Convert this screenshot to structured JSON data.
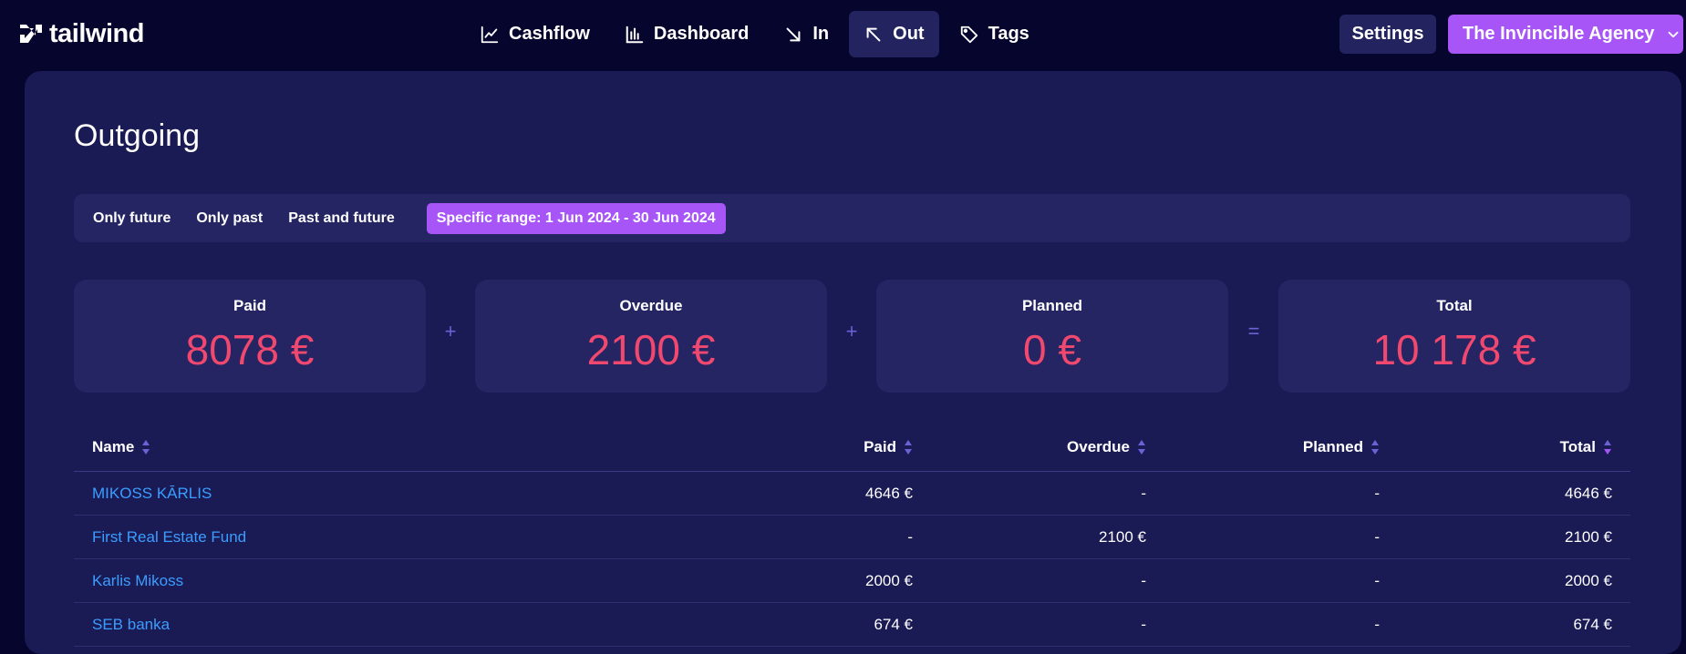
{
  "app": {
    "logo_text": "tailwind"
  },
  "nav": [
    {
      "label": "Cashflow",
      "icon": "line-chart-icon"
    },
    {
      "label": "Dashboard",
      "icon": "bar-chart-icon"
    },
    {
      "label": "In",
      "icon": "arrow-down-right-icon"
    },
    {
      "label": "Out",
      "icon": "arrow-up-left-icon",
      "active": true
    },
    {
      "label": "Tags",
      "icon": "tag-icon"
    }
  ],
  "header": {
    "settings_label": "Settings",
    "org_label": "The Invincible Agency"
  },
  "page": {
    "title": "Outgoing"
  },
  "filters": [
    {
      "label": "Only future"
    },
    {
      "label": "Only past"
    },
    {
      "label": "Past and future"
    },
    {
      "label": "Specific range: 1 Jun 2024 - 30 Jun 2024",
      "active": true
    }
  ],
  "stats": [
    {
      "label": "Paid",
      "value": "8078 €"
    },
    {
      "label": "Overdue",
      "value": "2100 €"
    },
    {
      "label": "Planned",
      "value": "0 €"
    },
    {
      "label": "Total",
      "value": "10 178 €"
    }
  ],
  "operators": [
    "+",
    "+",
    "="
  ],
  "table": {
    "columns": [
      "Name",
      "Paid",
      "Overdue",
      "Planned",
      "Total"
    ],
    "rows": [
      {
        "name": "MIKOSS KĀRLIS",
        "paid": "4646 €",
        "overdue": "-",
        "planned": "-",
        "total": "4646 €"
      },
      {
        "name": "First Real Estate Fund",
        "paid": "-",
        "overdue": "2100 €",
        "planned": "-",
        "total": "2100 €"
      },
      {
        "name": "Karlis Mikoss",
        "paid": "2000 €",
        "overdue": "-",
        "planned": "-",
        "total": "2000 €"
      },
      {
        "name": "SEB banka",
        "paid": "674 €",
        "overdue": "-",
        "planned": "-",
        "total": "674 €"
      }
    ]
  },
  "colors": {
    "background": "#05052e",
    "card": "#1a1a55",
    "panel": "#252564",
    "accent": "#a855f7",
    "value": "#f0486e",
    "link": "#3b9eff"
  }
}
